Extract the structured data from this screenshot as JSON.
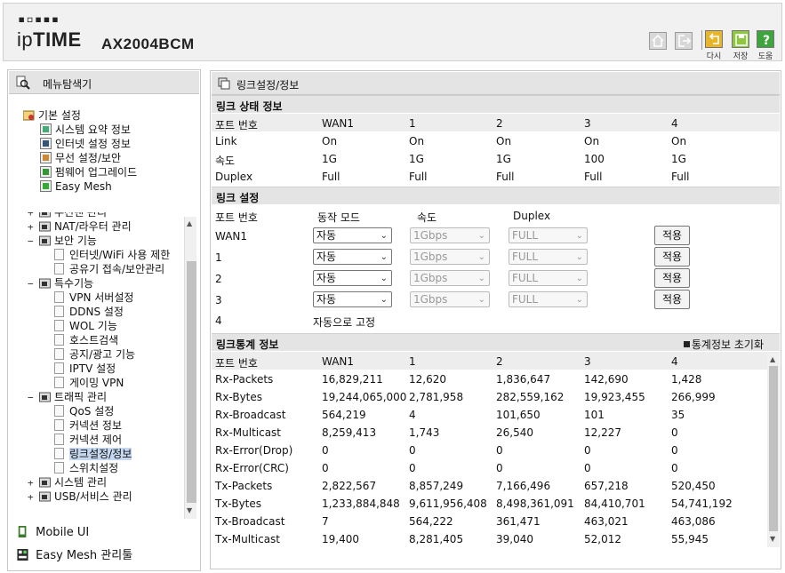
{
  "header": {
    "brand_dots": "▪▫▪▪▪",
    "brand_ip": "ip",
    "brand_time": "TIME",
    "model": "AX2004BCM",
    "buttons": [
      {
        "label": "다시",
        "color": "#e6b52a",
        "icon": "undo-icon"
      },
      {
        "label": "저장",
        "color": "#8ec63f",
        "icon": "save-icon"
      },
      {
        "label": "도움",
        "color": "#3da53c",
        "icon": "help-icon"
      }
    ]
  },
  "sidebar": {
    "title": "메뉴탐색기",
    "basic": {
      "label": "기본 설정",
      "items": [
        "시스템 요약 정보",
        "인터넷 설정 정보",
        "무선 설정/보안",
        "펌웨어 업그레이드",
        "Easy Mesh"
      ]
    },
    "advanced": [
      {
        "label": "무선랜 관리",
        "pm": "+"
      },
      {
        "label": "NAT/라우터 관리",
        "pm": "+"
      },
      {
        "label": "보안 기능",
        "pm": "−"
      },
      {
        "label": "인터넷/WiFi 사용 제한",
        "child": true
      },
      {
        "label": "공유기 접속/보안관리",
        "child": true
      },
      {
        "label": "특수기능",
        "pm": "−"
      },
      {
        "label": "VPN 서버설정",
        "child": true
      },
      {
        "label": "DDNS 설정",
        "child": true
      },
      {
        "label": "WOL 기능",
        "child": true
      },
      {
        "label": "호스트검색",
        "child": true
      },
      {
        "label": "공지/광고 기능",
        "child": true
      },
      {
        "label": "IPTV 설정",
        "child": true
      },
      {
        "label": "게이밍 VPN",
        "child": true
      },
      {
        "label": "트래픽 관리",
        "pm": "−"
      },
      {
        "label": "QoS 설정",
        "child": true
      },
      {
        "label": "커넥션 정보",
        "child": true
      },
      {
        "label": "커넥션 제어",
        "child": true
      },
      {
        "label": "링크설정/정보",
        "child": true,
        "selected": true
      },
      {
        "label": "스위치설정",
        "child": true
      },
      {
        "label": "시스템 관리",
        "pm": "+"
      },
      {
        "label": "USB/서비스 관리",
        "pm": "+"
      }
    ],
    "bottom": [
      "Mobile UI",
      "Easy Mesh 관리툴"
    ]
  },
  "main": {
    "title": "링크설정/정보",
    "status": {
      "title": "링크 상태 정보",
      "headers": [
        "포트 번호",
        "WAN1",
        "1",
        "2",
        "3",
        "4"
      ],
      "rows": [
        [
          "Link",
          "On",
          "On",
          "On",
          "On",
          "On"
        ],
        [
          "속도",
          "1G",
          "1G",
          "1G",
          "100",
          "1G"
        ],
        [
          "Duplex",
          "Full",
          "Full",
          "Full",
          "Full",
          "Full"
        ]
      ]
    },
    "config": {
      "title": "링크 설정",
      "headers": [
        "포트 번호",
        "동작 모드",
        "속도",
        "Duplex"
      ],
      "rows": [
        {
          "port": "WAN1",
          "mode": "자동",
          "speed": "1Gbps",
          "duplex": "FULL",
          "apply": "적용"
        },
        {
          "port": "1",
          "mode": "자동",
          "speed": "1Gbps",
          "duplex": "FULL",
          "apply": "적용"
        },
        {
          "port": "2",
          "mode": "자동",
          "speed": "1Gbps",
          "duplex": "FULL",
          "apply": "적용"
        },
        {
          "port": "3",
          "mode": "자동",
          "speed": "1Gbps",
          "duplex": "FULL",
          "apply": "적용"
        }
      ],
      "fixed_port": "4",
      "fixed_text": "자동으로 고정"
    },
    "stats": {
      "title": "링크통계 정보",
      "reset_label": "통계정보 초기화",
      "headers": [
        "포트 번호",
        "WAN1",
        "1",
        "2",
        "3",
        "4"
      ],
      "rows": [
        [
          "Rx-Packets",
          "16,829,211",
          "12,620",
          "1,836,647",
          "142,690",
          "1,428"
        ],
        [
          "Rx-Bytes",
          "19,244,065,000",
          "2,781,958",
          "282,559,162",
          "19,923,455",
          "266,999"
        ],
        [
          "Rx-Broadcast",
          "564,219",
          "4",
          "101,650",
          "101",
          "35"
        ],
        [
          "Rx-Multicast",
          "8,259,413",
          "1,743",
          "26,540",
          "12,227",
          "0"
        ],
        [
          "Rx-Error(Drop)",
          "0",
          "0",
          "0",
          "0",
          "0"
        ],
        [
          "Rx-Error(CRC)",
          "0",
          "0",
          "0",
          "0",
          "0"
        ],
        [
          "Tx-Packets",
          "2,822,567",
          "8,857,249",
          "7,166,496",
          "657,218",
          "520,450"
        ],
        [
          "Tx-Bytes",
          "1,233,884,848",
          "9,611,956,408",
          "8,498,361,091",
          "84,410,701",
          "54,741,192"
        ],
        [
          "Tx-Broadcast",
          "7",
          "564,222",
          "361,471",
          "463,021",
          "463,086"
        ],
        [
          "Tx-Multicast",
          "19,400",
          "8,281,405",
          "39,040",
          "52,012",
          "55,945"
        ]
      ]
    }
  }
}
